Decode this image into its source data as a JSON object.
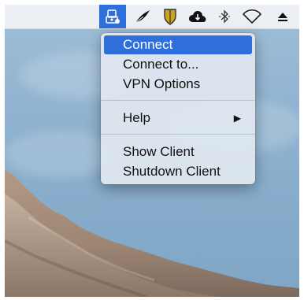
{
  "menubar": {
    "icons": [
      "vpn-icon",
      "feather-icon",
      "shield-icon",
      "cloud-icon",
      "bluetooth-icon",
      "wifi-icon",
      "eject-icon"
    ]
  },
  "menu": {
    "items": [
      {
        "label": "Connect"
      },
      {
        "label": "Connect to..."
      },
      {
        "label": "VPN Options"
      },
      {
        "label": "Help"
      },
      {
        "label": "Show Client"
      },
      {
        "label": "Shutdown Client"
      }
    ],
    "submenu_arrow": "▶"
  },
  "colors": {
    "highlight": "#2f6fdc",
    "menubar": "#eef1f5",
    "menu_bg": "#dee6ee",
    "sky": "#8fb2cf",
    "mountain": "#a98f7a"
  }
}
